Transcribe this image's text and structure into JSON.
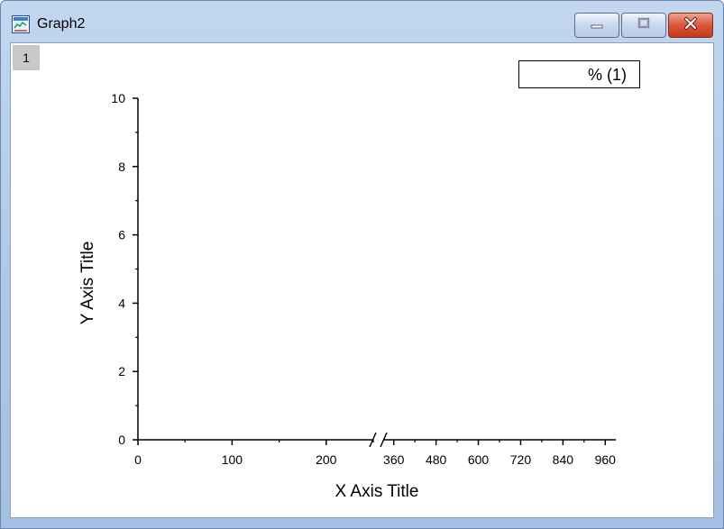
{
  "window": {
    "title": "Graph2",
    "app_icon": "origin-graph-icon",
    "buttons": {
      "minimize": "minimize-icon",
      "maximize": "maximize-icon",
      "close": "close-icon"
    }
  },
  "graph": {
    "layer_tab_label": "1",
    "legend_text": "% (1)"
  },
  "chart_data": {
    "type": "line",
    "xlabel": "X Axis Title",
    "ylabel": "Y Axis Title",
    "ylim": [
      0,
      10
    ],
    "y_ticks": [
      "0",
      "2",
      "4",
      "6",
      "8",
      "10"
    ],
    "x_axis_break": true,
    "x_segments": [
      {
        "range": [
          0,
          250
        ],
        "tick_labels": [
          "0",
          "100",
          "200"
        ],
        "tick_values": [
          0,
          100,
          200
        ]
      },
      {
        "range": [
          330,
          990
        ],
        "tick_labels": [
          "360",
          "480",
          "600",
          "720",
          "840",
          "960"
        ],
        "tick_values": [
          360,
          480,
          600,
          720,
          840,
          960
        ]
      }
    ],
    "series": [],
    "legend": [
      "% (1)"
    ],
    "grid": false
  }
}
